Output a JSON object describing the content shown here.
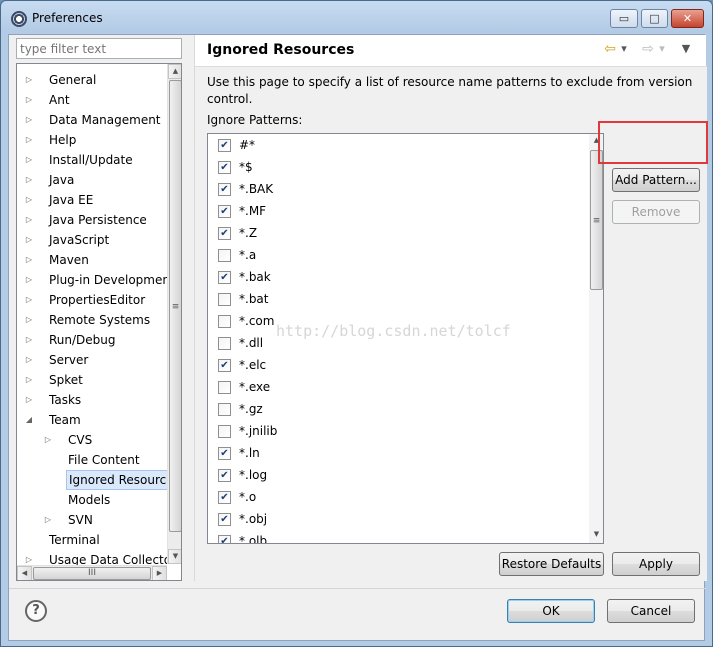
{
  "window": {
    "title": "Preferences",
    "min_glyph": "▭",
    "max_glyph": "□",
    "close_glyph": "✕"
  },
  "sidebar": {
    "filter_placeholder": "type filter text",
    "items": [
      {
        "label": "General",
        "indent": 0,
        "arrow": "▷"
      },
      {
        "label": "Ant",
        "indent": 0,
        "arrow": "▷"
      },
      {
        "label": "Data Management",
        "indent": 0,
        "arrow": "▷"
      },
      {
        "label": "Help",
        "indent": 0,
        "arrow": "▷"
      },
      {
        "label": "Install/Update",
        "indent": 0,
        "arrow": "▷"
      },
      {
        "label": "Java",
        "indent": 0,
        "arrow": "▷"
      },
      {
        "label": "Java EE",
        "indent": 0,
        "arrow": "▷"
      },
      {
        "label": "Java Persistence",
        "indent": 0,
        "arrow": "▷"
      },
      {
        "label": "JavaScript",
        "indent": 0,
        "arrow": "▷"
      },
      {
        "label": "Maven",
        "indent": 0,
        "arrow": "▷"
      },
      {
        "label": "Plug-in Development",
        "indent": 0,
        "arrow": "▷"
      },
      {
        "label": "PropertiesEditor",
        "indent": 0,
        "arrow": "▷"
      },
      {
        "label": "Remote Systems",
        "indent": 0,
        "arrow": "▷"
      },
      {
        "label": "Run/Debug",
        "indent": 0,
        "arrow": "▷"
      },
      {
        "label": "Server",
        "indent": 0,
        "arrow": "▷"
      },
      {
        "label": "Spket",
        "indent": 0,
        "arrow": "▷"
      },
      {
        "label": "Tasks",
        "indent": 0,
        "arrow": "▷"
      },
      {
        "label": "Team",
        "indent": 0,
        "arrow": "◢"
      },
      {
        "label": "CVS",
        "indent": 1,
        "arrow": "▷"
      },
      {
        "label": "File Content",
        "indent": 1,
        "arrow": ""
      },
      {
        "label": "Ignored Resource",
        "indent": 1,
        "arrow": "",
        "selected": true
      },
      {
        "label": "Models",
        "indent": 1,
        "arrow": ""
      },
      {
        "label": "SVN",
        "indent": 1,
        "arrow": "▷"
      },
      {
        "label": "Terminal",
        "indent": 0,
        "arrow": ""
      },
      {
        "label": "Usage Data Collector",
        "indent": 0,
        "arrow": "▷"
      }
    ],
    "scroll_up": "▲",
    "scroll_down": "▼",
    "scroll_left": "◀",
    "scroll_right": "▶",
    "grip": "≡",
    "hgrip": "III"
  },
  "main": {
    "title": "Ignored Resources",
    "nav": {
      "back": "⇦",
      "back_menu": "▾",
      "forward": "⇨",
      "forward_menu": "▾",
      "view_menu": "▼"
    },
    "description": "Use this page to specify a list of resource name patterns to exclude from version control.",
    "patterns_label": "Ignore Patterns:",
    "patterns": [
      {
        "text": "#*",
        "checked": true
      },
      {
        "text": "*$",
        "checked": true
      },
      {
        "text": "*.BAK",
        "checked": true
      },
      {
        "text": "*.MF",
        "checked": true
      },
      {
        "text": "*.Z",
        "checked": true
      },
      {
        "text": "*.a",
        "checked": false
      },
      {
        "text": "*.bak",
        "checked": true
      },
      {
        "text": "*.bat",
        "checked": false
      },
      {
        "text": "*.com",
        "checked": false
      },
      {
        "text": "*.dll",
        "checked": false
      },
      {
        "text": "*.elc",
        "checked": true
      },
      {
        "text": "*.exe",
        "checked": false
      },
      {
        "text": "*.gz",
        "checked": false
      },
      {
        "text": "*.jnilib",
        "checked": false
      },
      {
        "text": "*.ln",
        "checked": true
      },
      {
        "text": "*.log",
        "checked": true
      },
      {
        "text": "*.o",
        "checked": true
      },
      {
        "text": "*.obj",
        "checked": true
      },
      {
        "text": "*.olb",
        "checked": true
      }
    ],
    "watermark": "http://blog.csdn.net/tolcf",
    "add_pattern": "Add Pattern...",
    "remove": "Remove",
    "restore_defaults": "Restore Defaults",
    "apply": "Apply"
  },
  "footer": {
    "help": "?",
    "ok": "OK",
    "cancel": "Cancel"
  },
  "colors": {
    "highlight": "#e0393c",
    "selection": "#d9e8fb",
    "check": "#1d3e7a"
  }
}
